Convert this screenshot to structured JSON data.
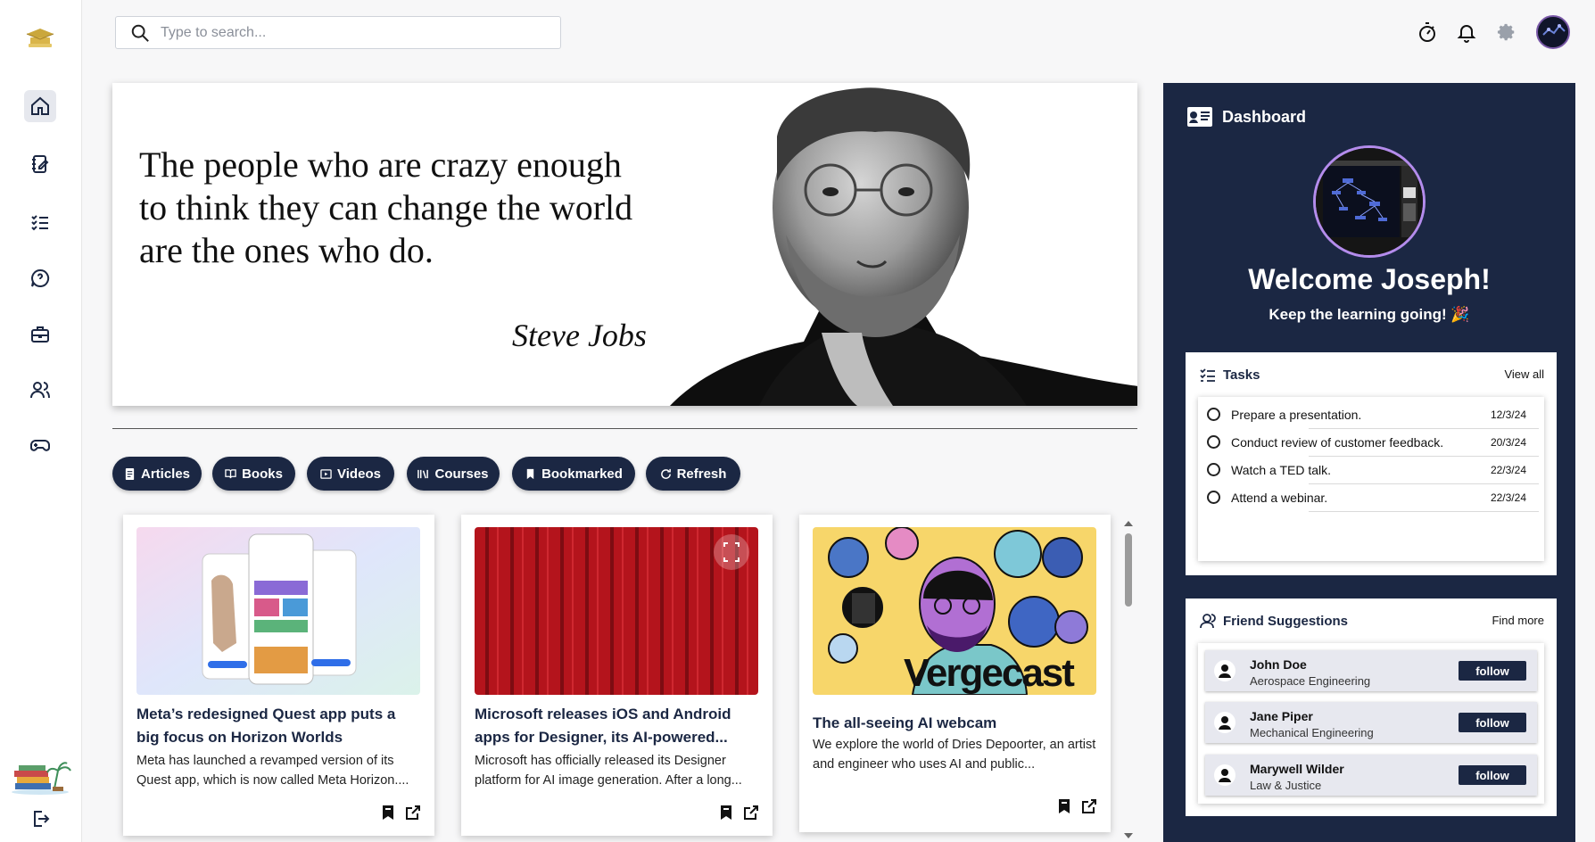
{
  "search": {
    "placeholder": "Type to search..."
  },
  "sidebar": {
    "items": [
      {
        "name": "home-icon"
      },
      {
        "name": "notebook-edit-icon"
      },
      {
        "name": "checklist-icon"
      },
      {
        "name": "chat-question-icon"
      },
      {
        "name": "briefcase-icon"
      },
      {
        "name": "users-icon"
      },
      {
        "name": "gamepad-icon"
      }
    ],
    "logout_icon": "logout-icon"
  },
  "banner": {
    "quote_lines": [
      "The people who are crazy enough",
      "to think they can change the world",
      "are the ones who do."
    ],
    "author": "Steve Jobs"
  },
  "filters": [
    "Articles",
    "Books",
    "Videos",
    "Courses",
    "Bookmarked",
    "Refresh"
  ],
  "cards": [
    {
      "title": "Meta’s redesigned Quest app puts a big focus on Horizon Worlds",
      "description": "Meta has launched a revamped version of its Quest app, which is now called Meta Horizon...."
    },
    {
      "title": "Microsoft releases iOS and Android apps for Designer, its AI-powered...",
      "description": "Microsoft has officially released its Designer platform for AI image generation. After a long..."
    },
    {
      "title": "The all-seeing AI webcam",
      "description": "We explore the world of Dries Depoorter, an artist and engineer who uses AI and public...",
      "image_text": "Vergecast"
    }
  ],
  "dashboard": {
    "title": "Dashboard",
    "welcome": "Welcome Joseph!",
    "tagline": "Keep the learning going! 🎉",
    "tasks": {
      "title": "Tasks",
      "link": "View all",
      "items": [
        {
          "label": "Prepare a presentation.",
          "date": "12/3/24"
        },
        {
          "label": "Conduct review of customer feedback.",
          "date": "20/3/24"
        },
        {
          "label": "Watch a TED talk.",
          "date": "22/3/24"
        },
        {
          "label": "Attend a webinar.",
          "date": "22/3/24"
        }
      ]
    },
    "friends": {
      "title": "Friend Suggestions",
      "link": "Find more",
      "follow_label": "follow",
      "items": [
        {
          "name": "John Doe",
          "dept": "Aerospace Engineering"
        },
        {
          "name": "Jane Piper",
          "dept": "Mechanical Engineering"
        },
        {
          "name": "Marywell Wilder",
          "dept": "Law & Justice"
        }
      ]
    }
  },
  "colors": {
    "navy": "#1b2743",
    "avatar_ring": "#b48cec",
    "page_bg": "#f7f7f8"
  }
}
